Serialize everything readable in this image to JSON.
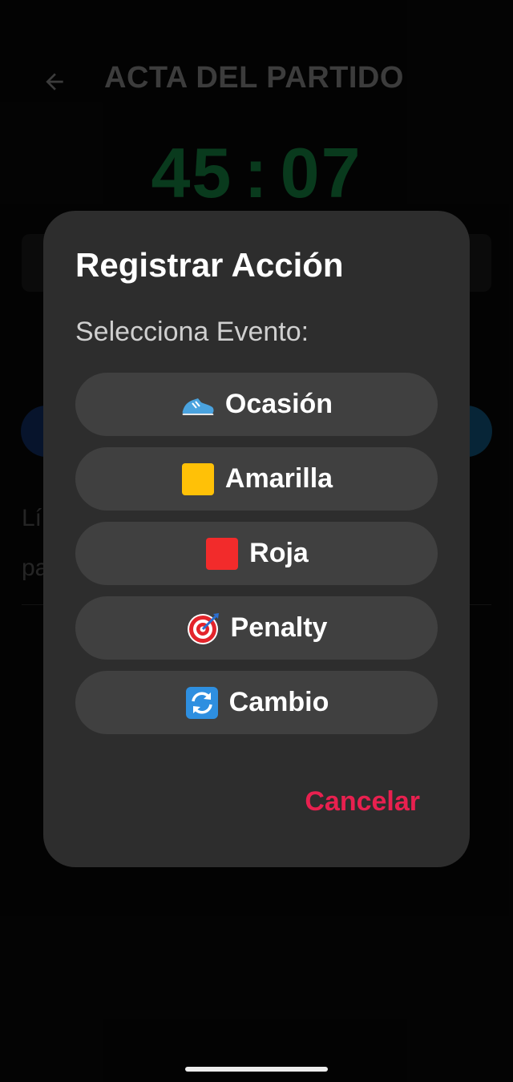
{
  "header": {
    "back_icon": "arrow-left-icon",
    "title": "ACTA DEL PARTIDO"
  },
  "timer": {
    "minutes": "45",
    "separator": ":",
    "seconds": "07"
  },
  "background": {
    "partial_text_1": "Lí",
    "partial_text_2": "pa"
  },
  "dialog": {
    "title": "Registrar Acción",
    "subtitle": "Selecciona Evento:",
    "options": [
      {
        "label": "Ocasión",
        "icon": "sneaker-icon"
      },
      {
        "label": "Amarilla",
        "icon": "yellow-square-icon"
      },
      {
        "label": "Roja",
        "icon": "red-square-icon"
      },
      {
        "label": "Penalty",
        "icon": "target-icon"
      },
      {
        "label": "Cambio",
        "icon": "arrows-cycle-icon"
      }
    ],
    "cancel_label": "Cancelar"
  },
  "colors": {
    "accent_cancel": "#e8204f",
    "timer_green": "#0e5a2d",
    "dialog_bg": "#2d2d2d",
    "option_bg": "#404040"
  }
}
